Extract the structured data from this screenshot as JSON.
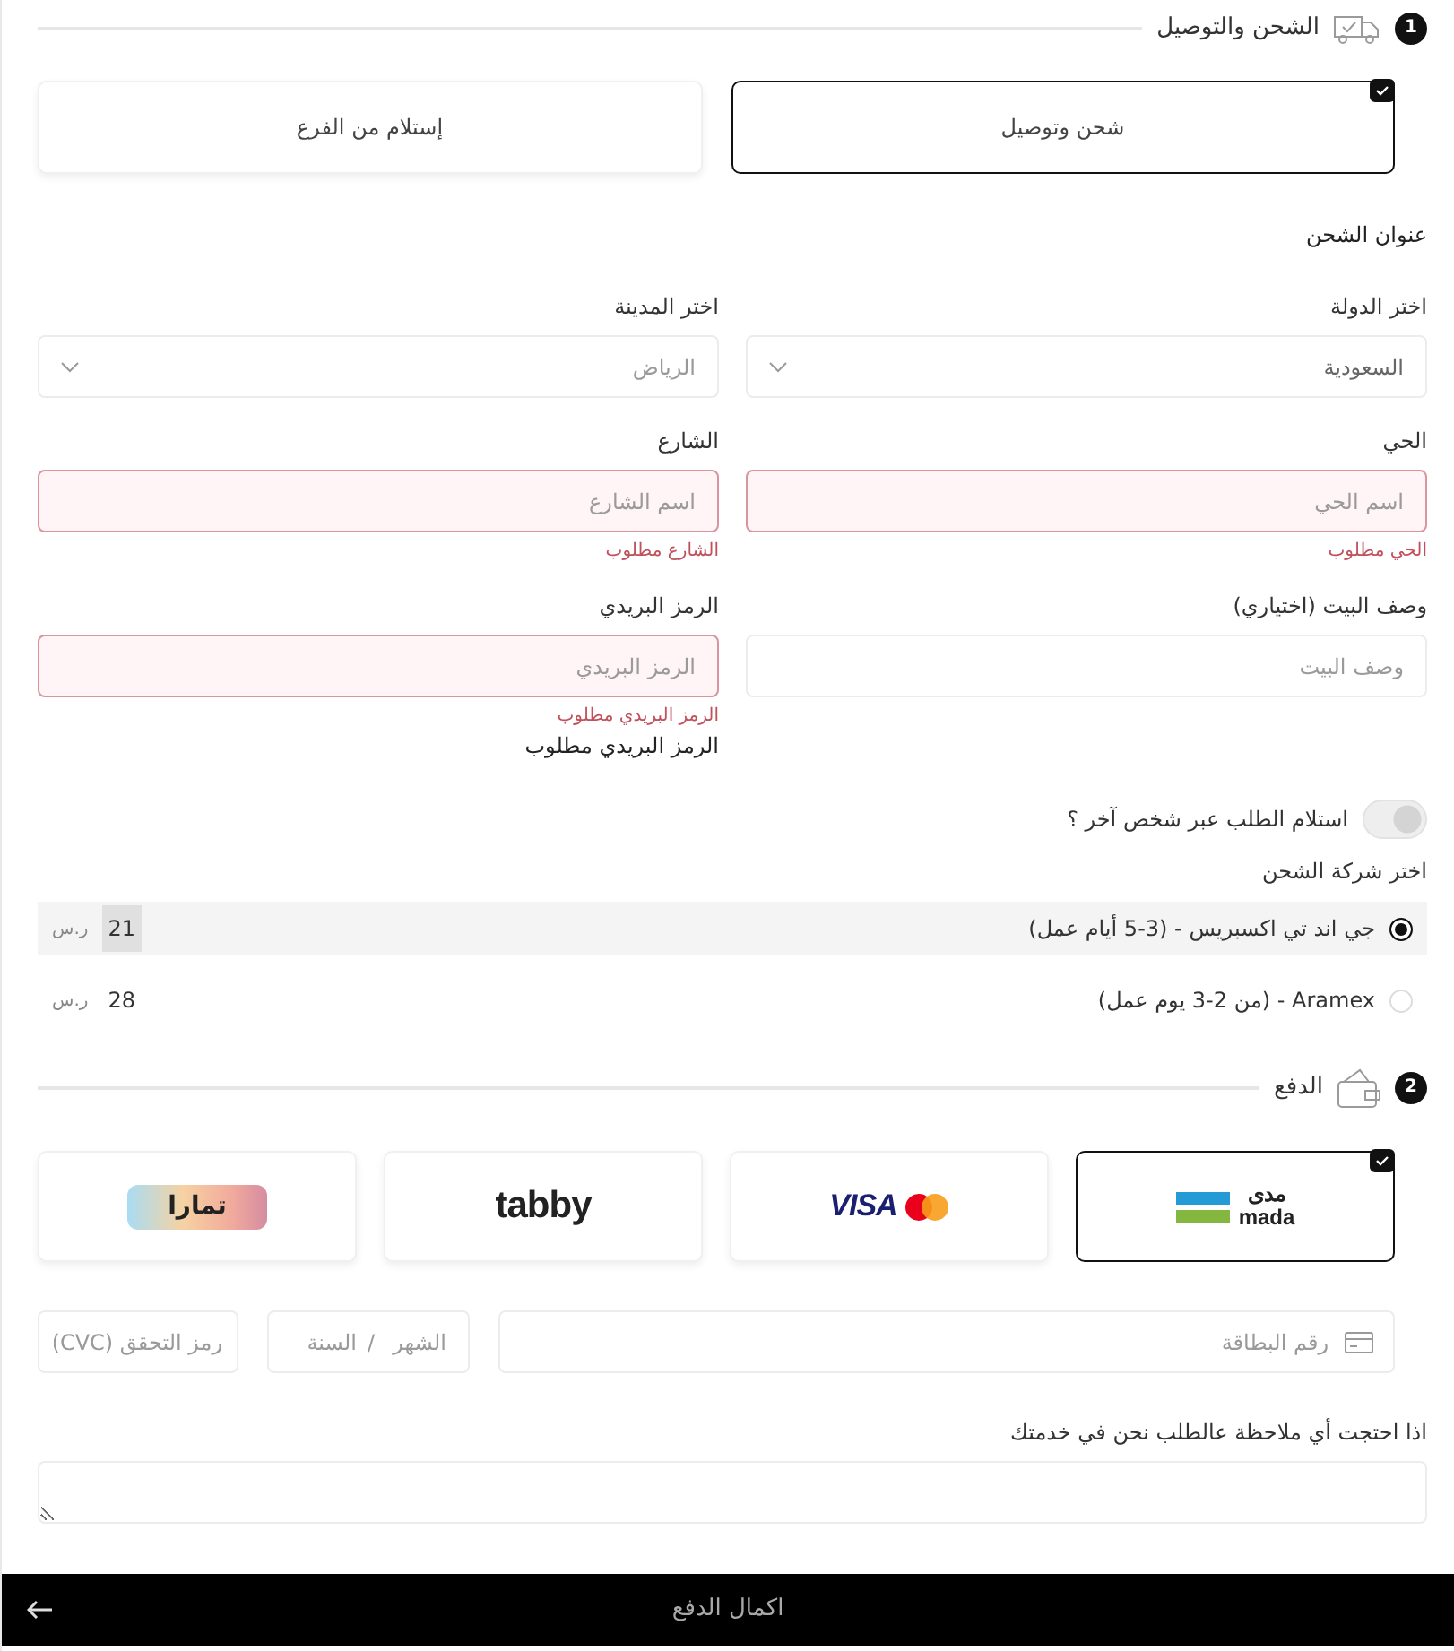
{
  "shipping_section": {
    "number": "1",
    "title": "الشحن والتوصيل"
  },
  "delivery_methods": [
    {
      "label": "شحن وتوصيل",
      "selected": true
    },
    {
      "label": "إستلام من الفرع",
      "selected": false
    }
  ],
  "address": {
    "title": "عنوان الشحن",
    "fields": [
      {
        "kind": "select",
        "label": "اختر الدولة",
        "value": "السعودية"
      },
      {
        "kind": "select",
        "label": "اختر المدينة",
        "value": "الرياض"
      },
      {
        "kind": "input",
        "label": "الحي",
        "placeholder": "اسم الحي",
        "invalid": true,
        "error": "الحي مطلوب"
      },
      {
        "kind": "input",
        "label": "الشارع",
        "placeholder": "اسم الشارع",
        "invalid": true,
        "error": "الشارع مطلوب"
      },
      {
        "kind": "input",
        "label": "وصف البيت (اختياري)",
        "placeholder": "وصف البيت",
        "invalid": false
      },
      {
        "kind": "input",
        "label": "الرمز البريدي",
        "placeholder": "الرمز البريدي",
        "invalid": true,
        "error": "الرمز البريدي مطلوب",
        "note": "الرمز البريدي مطلوب"
      }
    ]
  },
  "receive_by_other": {
    "label": "استلام الطلب عبر شخص آخر ؟",
    "on": false
  },
  "carriers": {
    "title": "اختر شركة الشحن",
    "options": [
      {
        "name": "جي اند تي اكسبريس - (3-5 أيام عمل)",
        "price": "21",
        "currency": "ر.س",
        "selected": true
      },
      {
        "name": "Aramex - (من 2-3 يوم عمل)",
        "price": "28",
        "currency": "ر.س",
        "selected": false
      }
    ]
  },
  "payment_section": {
    "number": "2",
    "title": "الدفع"
  },
  "payment_methods": [
    {
      "kind": "mada",
      "logo_lines": [
        "مدى",
        "mada"
      ],
      "selected": true
    },
    {
      "kind": "visa",
      "logo_lines": [
        "VISA"
      ],
      "selected": false
    },
    {
      "kind": "tabby",
      "logo_lines": [
        "tabby"
      ],
      "selected": false
    },
    {
      "kind": "tamara",
      "logo_lines": [
        "تمارا"
      ],
      "selected": false
    }
  ],
  "card": {
    "number_placeholder": "رقم البطاقة",
    "month_placeholder": "الشهر",
    "separator": "/",
    "year_placeholder": "السنة",
    "cvc_placeholder": "رمز التحقق (CVC)"
  },
  "note": {
    "label": "اذا احتجت أي ملاحظة عالطلب نحن في خدمتك"
  },
  "submit": {
    "label": "اكمال الدفع"
  }
}
